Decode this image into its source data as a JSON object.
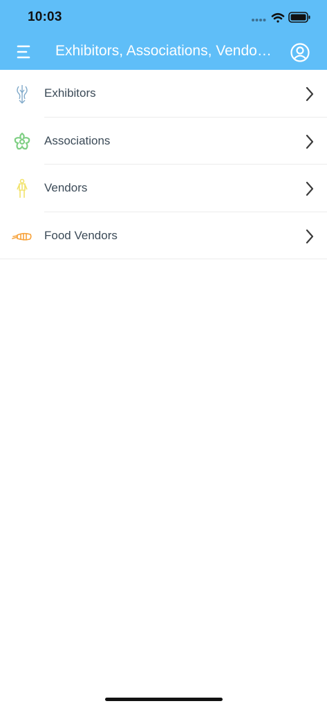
{
  "status_bar": {
    "time": "10:03"
  },
  "nav": {
    "title": "Exhibitors, Associations, Vendors, Food Vendors",
    "menu_icon": "hamburger-icon",
    "profile_icon": "user-circle-icon"
  },
  "list": {
    "items": [
      {
        "label": "Exhibitors",
        "icon": "dragon-emblem-icon",
        "icon_color": "#7fa9c9"
      },
      {
        "label": "Associations",
        "icon": "flower-icon",
        "icon_color": "#7fcf84"
      },
      {
        "label": "Vendors",
        "icon": "figure-icon",
        "icon_color": "#f2e36b"
      },
      {
        "label": "Food Vendors",
        "icon": "shrimp-icon",
        "icon_color": "#f7a23a"
      }
    ]
  },
  "colors": {
    "header_bg": "#5fbef8",
    "label_text": "#3b4a57",
    "chevron": "#3a3a3a"
  }
}
